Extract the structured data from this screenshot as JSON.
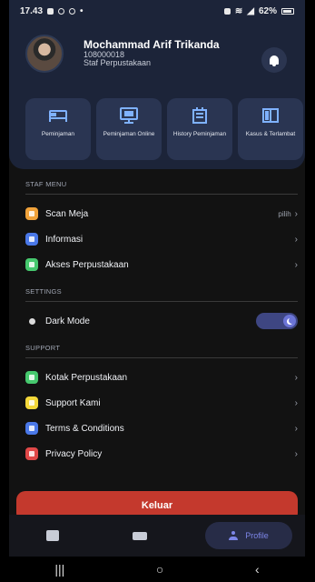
{
  "status_bar": {
    "time": "17.43",
    "battery": "62%"
  },
  "profile": {
    "name": "Mochammad Arif Trikanda",
    "id": "108000018",
    "role": "Staf Perpustakaan"
  },
  "quick_actions": [
    {
      "label": "Peminjaman",
      "icon": "bed-icon",
      "color": "#7fb2ff"
    },
    {
      "label": "Peminjaman Online",
      "icon": "monitor-icon",
      "color": "#7fb2ff"
    },
    {
      "label": "History Peminjaman",
      "icon": "history-icon",
      "color": "#7fb2ff"
    },
    {
      "label": "Kasus & Terlambat",
      "icon": "book-icon",
      "color": "#7fb2ff"
    }
  ],
  "sections": {
    "staf_menu": "STAF MENU",
    "settings": "SETTINGS",
    "support": "SUPPORT"
  },
  "staf_menu_items": [
    {
      "label": "Scan Meja",
      "right": "pilih",
      "color": "#f0a23a"
    },
    {
      "label": "Informasi",
      "right": "",
      "color": "#4a78e8"
    },
    {
      "label": "Akses Perpustakaan",
      "right": "",
      "color": "#46c86e"
    }
  ],
  "settings_items": [
    {
      "label": "Dark Mode",
      "toggle_on": true
    }
  ],
  "support_items": [
    {
      "label": "Kotak Perpustakaan",
      "color": "#46c86e"
    },
    {
      "label": "Support Kami",
      "color": "#f4d83a"
    },
    {
      "label": "Terms & Conditions",
      "color": "#4a78e8"
    },
    {
      "label": "Privacy Policy",
      "color": "#e04848"
    }
  ],
  "logout": {
    "label": "Keluar"
  },
  "bottom_nav": {
    "active_label": "Profile"
  },
  "colors": {
    "header_bg": "#1c2439",
    "card_bg": "#2a3552",
    "accent": "#6b74d6",
    "logout": "#c4392d"
  }
}
